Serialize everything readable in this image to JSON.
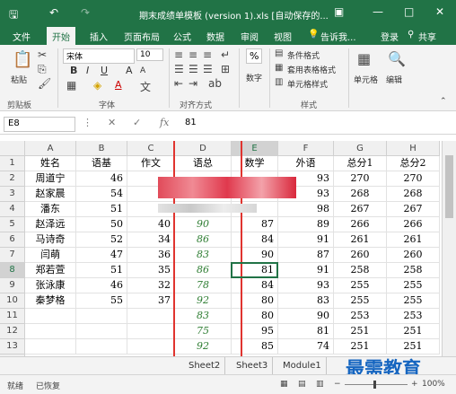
{
  "titlebar": {
    "save_icon": "save-icon",
    "undo_icon": "undo-icon",
    "redo_icon": "redo-icon",
    "title": "期末成绩单模板 (version 1).xls [自动保存的...",
    "minimize": "—",
    "restore": "□",
    "close": "✕"
  },
  "menu": {
    "tabs": [
      "文件",
      "开始",
      "插入",
      "页面布局",
      "公式",
      "数据",
      "审阅",
      "视图"
    ],
    "active": "开始",
    "tellme": "告诉我...",
    "login": "登录",
    "share": "共享"
  },
  "ribbon": {
    "paste": "粘贴",
    "font_name": "宋体",
    "font_size": "10",
    "bold": "B",
    "italic": "I",
    "underline": "U",
    "grow_font": "A",
    "shrink_font": "A",
    "number": "数字",
    "percent": "%",
    "cond_format": "条件格式",
    "table_format": "套用表格格式",
    "cell_style": "单元格样式",
    "cells": "单元格",
    "edit": "编辑",
    "groups": {
      "clipboard": "剪贴板",
      "font": "字体",
      "align": "对齐方式",
      "styles": "样式"
    }
  },
  "formulabar": {
    "name_box": "E8",
    "cancel": "✕",
    "enter": "✓",
    "fx": "fx",
    "value": "81"
  },
  "sheet": {
    "columns": [
      "A",
      "B",
      "C",
      "D",
      "E",
      "F",
      "G",
      "H"
    ],
    "rows": [
      "1",
      "2",
      "3",
      "4",
      "5",
      "6",
      "7",
      "8",
      "9",
      "10",
      "11",
      "12",
      "13",
      "14"
    ],
    "header": [
      "姓名",
      "语基",
      "作文",
      "语总",
      "数学",
      "外语",
      "总分1",
      "总分2"
    ],
    "data": [
      [
        "周道宁",
        "46",
        "",
        "",
        "",
        "93",
        "270",
        "270"
      ],
      [
        "赵家晨",
        "54",
        "",
        "",
        "",
        "93",
        "268",
        "268"
      ],
      [
        "潘东",
        "51",
        "",
        "",
        "",
        "98",
        "267",
        "267"
      ],
      [
        "赵泽远",
        "50",
        "40",
        "90",
        "87",
        "89",
        "266",
        "266"
      ],
      [
        "马诗奇",
        "52",
        "34",
        "86",
        "84",
        "91",
        "261",
        "261"
      ],
      [
        "闫萌",
        "47",
        "36",
        "83",
        "90",
        "87",
        "260",
        "260"
      ],
      [
        "郑若萱",
        "51",
        "35",
        "86",
        "81",
        "91",
        "258",
        "258"
      ],
      [
        "张泳康",
        "46",
        "32",
        "78",
        "84",
        "93",
        "255",
        "255"
      ],
      [
        "秦梦格",
        "55",
        "37",
        "92",
        "80",
        "83",
        "255",
        "255"
      ],
      [
        "",
        "",
        "",
        "83",
        "80",
        "90",
        "253",
        "253"
      ],
      [
        "",
        "",
        "",
        "75",
        "95",
        "81",
        "251",
        "251"
      ],
      [
        "",
        "",
        "",
        "92",
        "85",
        "74",
        "251",
        "251"
      ]
    ]
  },
  "sheets": [
    "Sheet2",
    "Sheet3",
    "Module1"
  ],
  "status": {
    "ready": "就绪",
    "recovered": "已恢复",
    "zoom": "100%"
  },
  "watermark": "最需教育"
}
